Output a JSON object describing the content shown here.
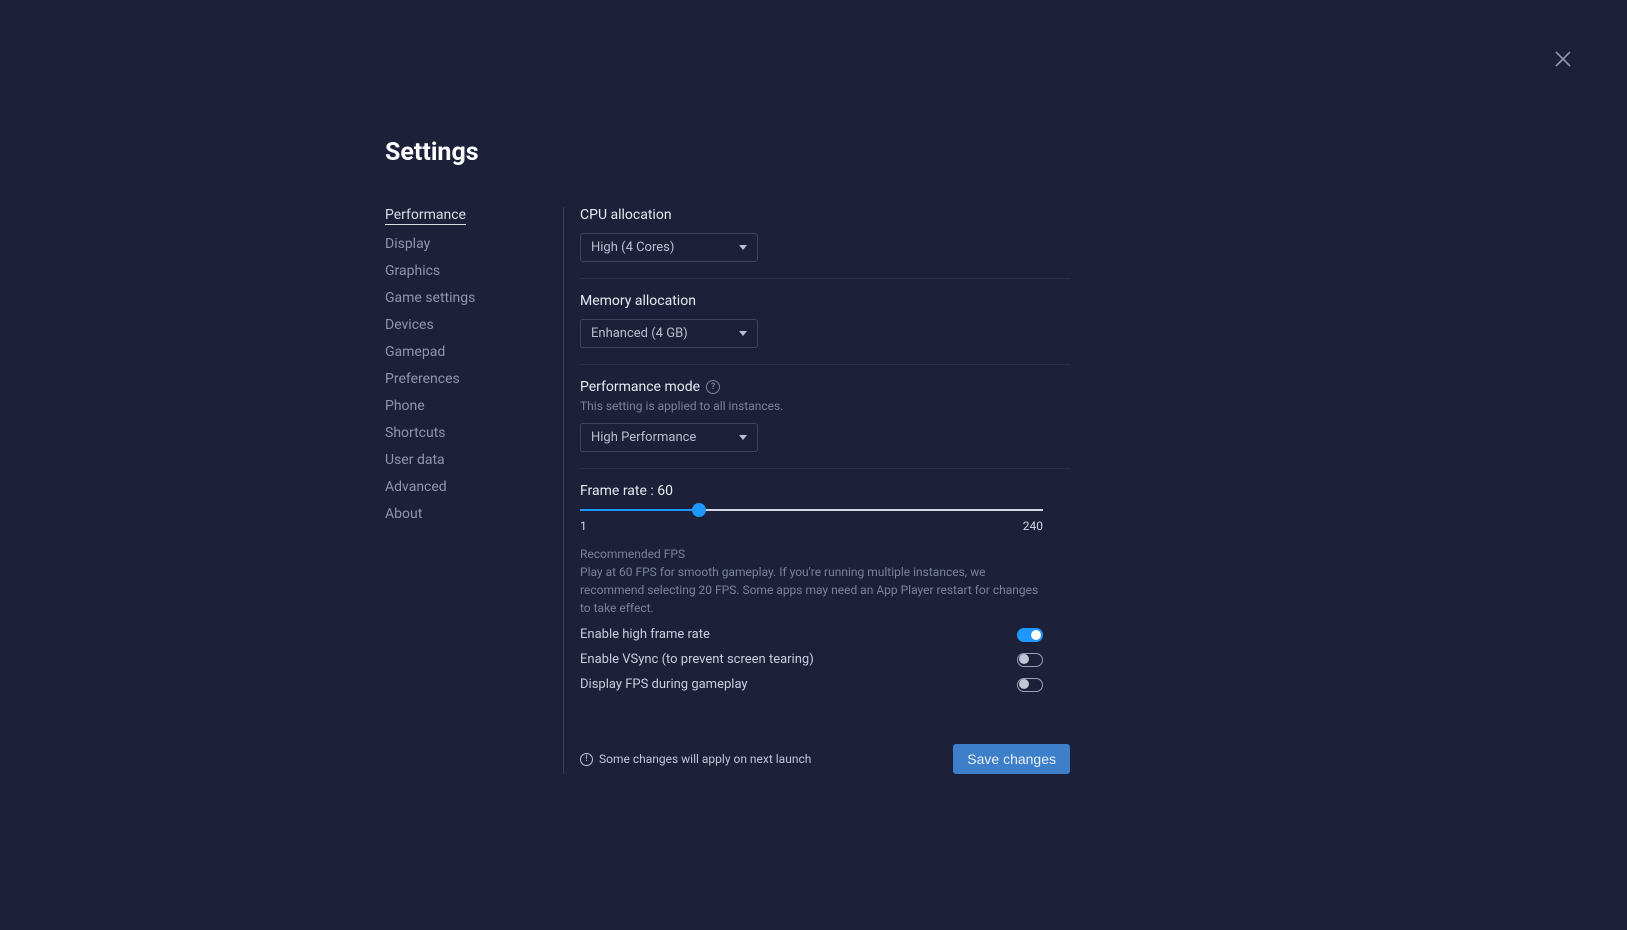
{
  "page_title": "Settings",
  "sidebar": {
    "items": [
      {
        "label": "Performance",
        "active": true
      },
      {
        "label": "Display"
      },
      {
        "label": "Graphics"
      },
      {
        "label": "Game settings"
      },
      {
        "label": "Devices"
      },
      {
        "label": "Gamepad"
      },
      {
        "label": "Preferences"
      },
      {
        "label": "Phone"
      },
      {
        "label": "Shortcuts"
      },
      {
        "label": "User data"
      },
      {
        "label": "Advanced"
      },
      {
        "label": "About"
      }
    ]
  },
  "cpu": {
    "label": "CPU allocation",
    "value": "High (4 Cores)"
  },
  "memory": {
    "label": "Memory allocation",
    "value": "Enhanced (4 GB)"
  },
  "perf_mode": {
    "label": "Performance mode",
    "sublabel": "This setting is applied to all instances.",
    "value": "High Performance"
  },
  "frame_rate": {
    "label": "Frame rate : 60",
    "value": 60,
    "min": "1",
    "max": "240",
    "fill_pct": "25.6%",
    "rec_title": "Recommended FPS",
    "rec_body": "Play at 60 FPS for smooth gameplay. If you're running multiple instances, we recommend selecting 20 FPS. Some apps may need an App Player restart for changes to take effect."
  },
  "toggles": {
    "high_fps": {
      "label": "Enable high frame rate",
      "on": true
    },
    "vsync": {
      "label": "Enable VSync (to prevent screen tearing)",
      "on": false
    },
    "show_fps": {
      "label": "Display FPS during gameplay",
      "on": false
    }
  },
  "footer": {
    "note": "Some changes will apply on next launch",
    "save": "Save changes"
  }
}
